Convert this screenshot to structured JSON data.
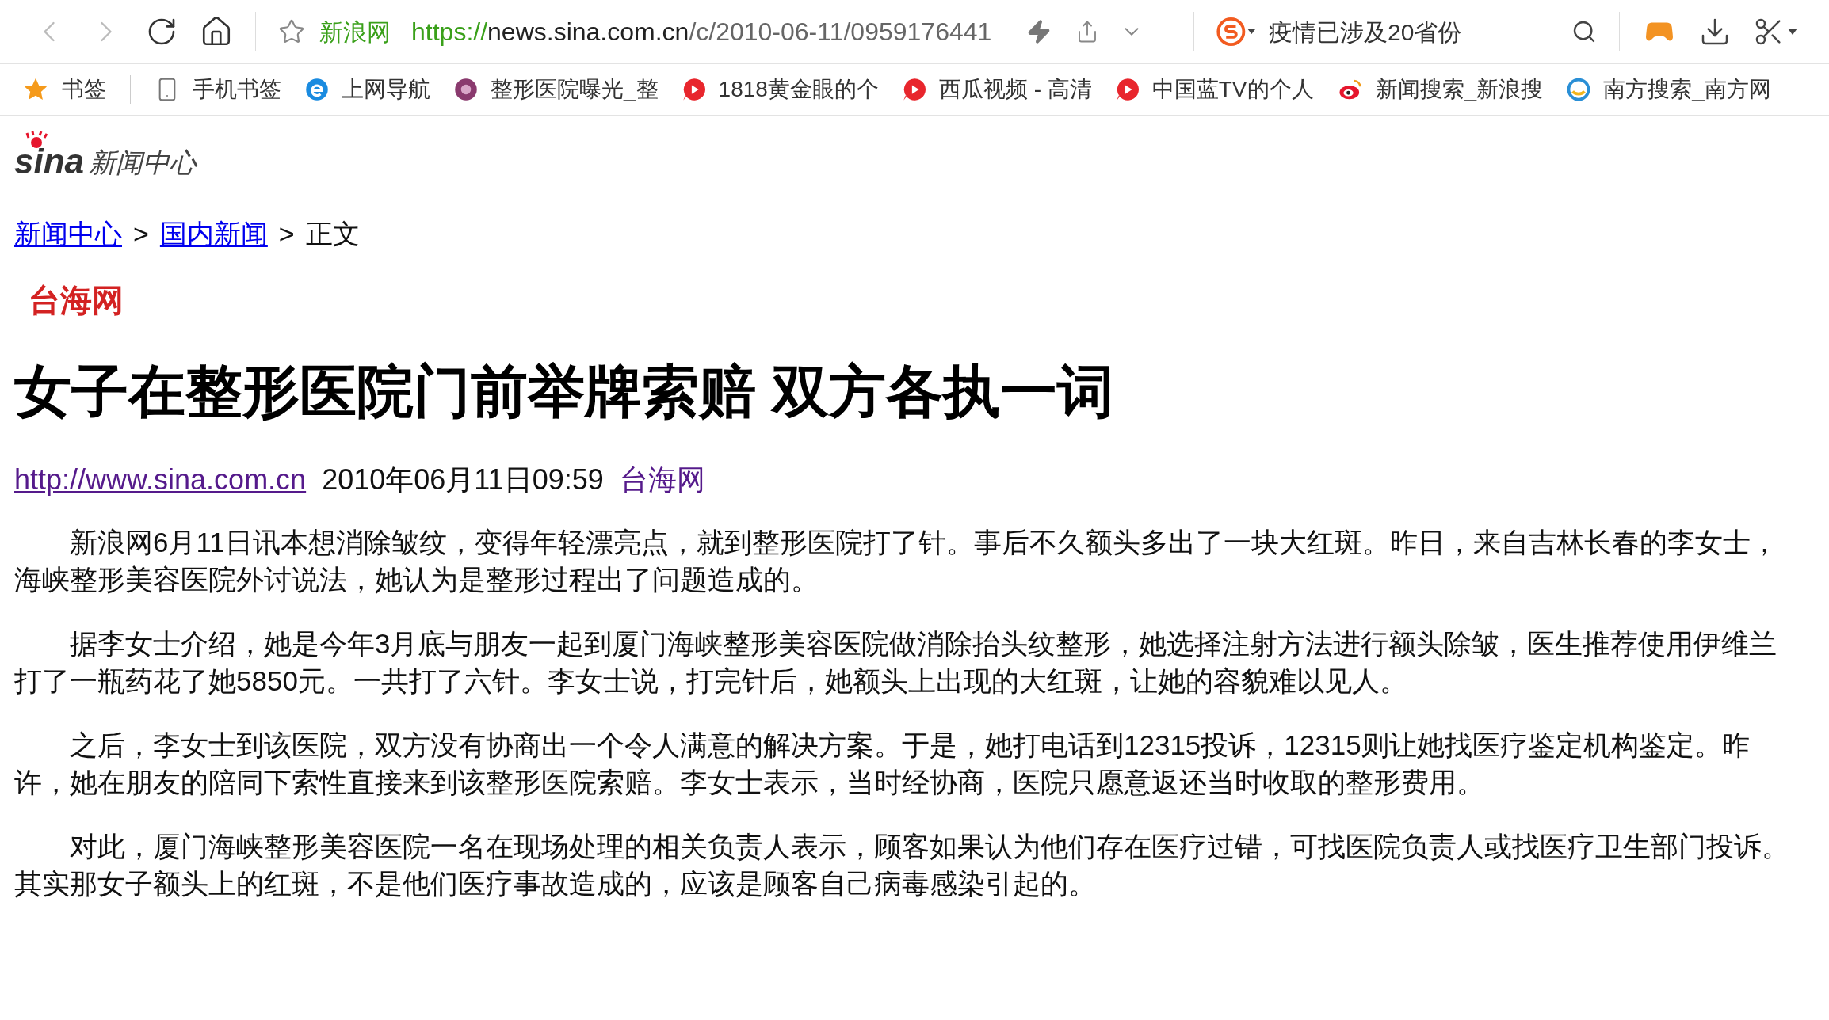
{
  "toolbar": {
    "site_name": "新浪网",
    "url_scheme": "https://",
    "url_host": "news.sina.com.cn",
    "url_path": "/c/2010-06-11/0959176441",
    "search_text": "疫情已涉及20省份"
  },
  "bookmarks": [
    {
      "label": "书签",
      "kind": "star"
    },
    {
      "label": "手机书签",
      "kind": "phone"
    },
    {
      "label": "上网导航",
      "kind": "ie"
    },
    {
      "label": "整形医院曝光_整",
      "kind": "flower"
    },
    {
      "label": "1818黄金眼的个",
      "kind": "play"
    },
    {
      "label": "西瓜视频 - 高清",
      "kind": "play"
    },
    {
      "label": "中国蓝TV的个人",
      "kind": "play"
    },
    {
      "label": "新闻搜索_新浪搜",
      "kind": "weibo"
    },
    {
      "label": "南方搜索_南方网",
      "kind": "swirl"
    }
  ],
  "logo": {
    "brand": "sina",
    "section": "新闻中心"
  },
  "breadcrumb": [
    {
      "label": "新闻中心",
      "link": true
    },
    {
      "label": "国内新闻",
      "link": true
    },
    {
      "label": "正文",
      "link": false
    }
  ],
  "breadcrumb_separator": ">",
  "source_logo": "台海网",
  "headline": "女子在整形医院门前举牌索赔 双方各执一词",
  "meta": {
    "url": "http://www.sina.com.cn",
    "datetime": "2010年06月11日09:59",
    "source": "台海网"
  },
  "paragraphs": [
    {
      "lines": [
        "新浪网6月11日讯本想消除皱纹，变得年轻漂亮点，就到整形医院打了针。事后不久额头多出了一块大红斑。昨日，来自吉林长春的李女士，",
        "海峡整形美容医院外讨说法，她认为是整形过程出了问题造成的。"
      ]
    },
    {
      "lines": [
        "据李女士介绍，她是今年3月底与朋友一起到厦门海峡整形美容医院做消除抬头纹整形，她选择注射方法进行额头除皱，医生推荐使用伊维兰",
        "打了一瓶药花了她5850元。一共打了六针。李女士说，打完针后，她额头上出现的大红斑，让她的容貌难以见人。"
      ]
    },
    {
      "lines": [
        "之后，李女士到该医院，双方没有协商出一个令人满意的解决方案。于是，她打电话到12315投诉，12315则让她找医疗鉴定机构鉴定。昨",
        "许，她在朋友的陪同下索性直接来到该整形医院索赔。李女士表示，当时经协商，医院只愿意返还当时收取的整形费用。"
      ]
    },
    {
      "lines": [
        "对此，厦门海峡整形美容医院一名在现场处理的相关负责人表示，顾客如果认为他们存在医疗过错，可找医院负责人或找医疗卫生部门投诉。",
        "其实那女子额头上的红斑，不是他们医疗事故造成的，应该是顾客自己病毒感染引起的。"
      ]
    }
  ]
}
